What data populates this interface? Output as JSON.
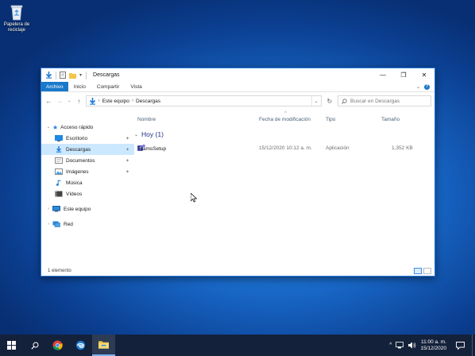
{
  "desktop": {
    "recycle_bin_label": "Papelera de reciclaje"
  },
  "window": {
    "title": "Descargas",
    "ribbon_tabs": [
      "Archivo",
      "Inicio",
      "Compartir",
      "Vista"
    ],
    "breadcrumb": [
      "Este equipo",
      "Descargas"
    ],
    "search_placeholder": "Buscar en Descargas",
    "nav": {
      "quick_access": "Acceso rápido",
      "items": [
        "Escritorio",
        "Descargas",
        "Documentos",
        "Imágenes",
        "Música",
        "Vídeos"
      ],
      "this_pc": "Este equipo",
      "network": "Red"
    },
    "columns": {
      "name": "Nombre",
      "modified": "Fecha de modificación",
      "type": "Tipo",
      "size": "Tamaño"
    },
    "group_label": "Hoy (1)",
    "files": [
      {
        "name": "TeamsSetup",
        "modified": "15/12/2020 10:12 a. m.",
        "type": "Aplicación",
        "size": "1,352 KB"
      }
    ],
    "status_text": "1 elemento"
  },
  "taskbar": {
    "time": "11:00 a. m.",
    "date": "15/12/2020"
  },
  "colors": {
    "accent": "#1979ca",
    "selection": "#cce8ff",
    "taskbar": "#14213a"
  }
}
